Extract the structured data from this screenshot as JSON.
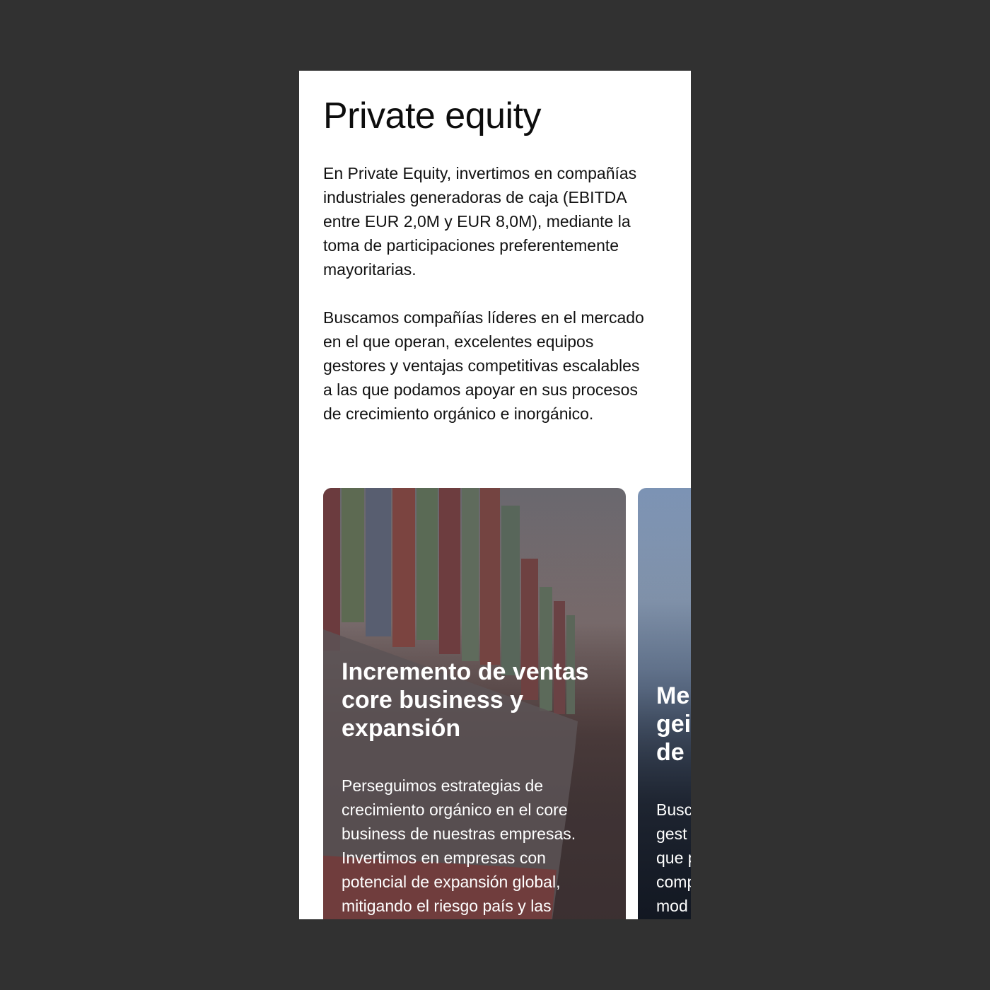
{
  "page": {
    "title": "Private equity",
    "paragraphs": [
      "En Private Equity, invertimos en compañías\nindustriales generadoras de caja (EBITDA\nentre EUR 2,0M y EUR 8,0M), mediante la\ntoma de participaciones preferentemente\nmayoritarias.",
      "Buscamos compañías líderes en el mercado\nen el que operan, excelentes equipos\ngestores y ventajas competitivas escalables\na las que podamos apoyar en sus procesos\nde crecimiento orgánico e inorgánico."
    ]
  },
  "cards": [
    {
      "title": "Incremento de ventas\ncore business y\nexpansión",
      "text": "Perseguimos estrategias de\ncrecimiento orgánico en el  core\nbusiness  de nuestras empresas.\nInvertimos en empresas con\npotencial de expansión global,\nmitigando el riesgo país y las",
      "image": "container-ship-photo"
    },
    {
      "title": "Me\ngei\nde",
      "text": "Busc\ngest\nque p\ncomp\nmod",
      "image": "person-photo"
    }
  ]
}
